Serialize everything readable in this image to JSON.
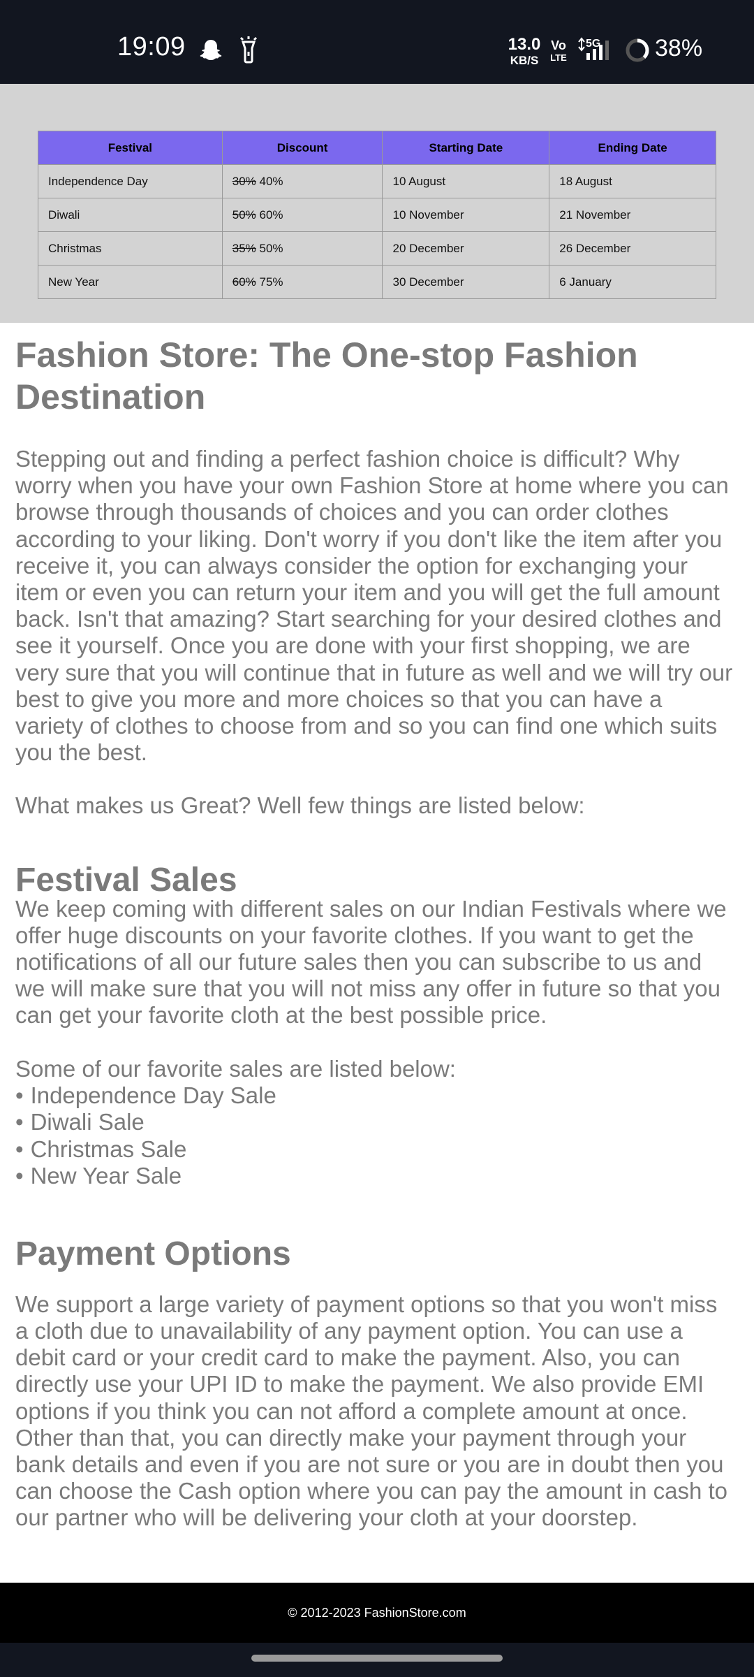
{
  "status_bar": {
    "time": "19:09",
    "net_speed_value": "13.0",
    "net_speed_unit": "KB/S",
    "volte_top": "Vo",
    "volte_bottom": "LTE",
    "network_type": "5G",
    "battery": "38%",
    "icons": [
      "snapchat-icon",
      "torch-icon",
      "signal-icon",
      "battery-ring-icon"
    ]
  },
  "table": {
    "headers": [
      "Festival",
      "Discount",
      "Starting Date",
      "Ending Date"
    ],
    "rows": [
      {
        "festival": "Independence Day",
        "old_discount": "30%",
        "discount": "40%",
        "start": "10 August",
        "end": "18 August"
      },
      {
        "festival": "Diwali",
        "old_discount": "50%",
        "discount": "60%",
        "start": "10 November",
        "end": "21 November"
      },
      {
        "festival": "Christmas",
        "old_discount": "35%",
        "discount": "50%",
        "start": "20 December",
        "end": "26 December"
      },
      {
        "festival": "New Year",
        "old_discount": "60%",
        "discount": "75%",
        "start": "30 December",
        "end": "6 January"
      }
    ]
  },
  "article": {
    "title": "Fashion Store: The One-stop Fashion Destination",
    "intro": "Stepping out and finding a perfect fashion choice is difficult? Why worry when you have your own Fashion Store at home where you can browse through thousands of choices and you can order clothes according to your liking. Don't worry if you don't like the item after you receive it, you can always consider the option for exchanging your item or even you can return your item and you will get the full amount back. Isn't that amazing? Start searching for your desired clothes and see it yourself. Once you are done with your first shopping, we are very sure that you will continue that in future as well and we will try our best to give you more and more choices so that you can have a variety of clothes to choose from and so you can find one which suits you the best.",
    "great": "What makes us Great? Well few things are listed below:",
    "festival_heading": "Festival Sales",
    "festival_text": "We keep coming with different sales on our Indian Festivals where we offer huge discounts on your favorite clothes. If you want to get the notifications of all our future sales then you can subscribe to us and we will make sure that you will not miss any offer in future so that you can get your favorite cloth at the best possible price.",
    "favorite_intro": "Some of our favorite sales are listed below:",
    "sales_list": [
      "Independence Day Sale",
      "Diwali Sale",
      "Christmas Sale",
      "New Year Sale"
    ],
    "payment_heading": "Payment Options",
    "payment_text": "We support a large variety of payment options so that you won't miss a cloth due to unavailability of any payment option. You can use a debit card or your credit card to make the payment. Also, you can directly use your UPI ID to make the payment. We also provide EMI options if you think you can not afford a complete amount at once. Other than that, you can directly make your payment through your bank details and even if you are not sure or you are in doubt then you can choose the Cash option where you can pay the amount in cash to our partner who will be delivering your cloth at your doorstep."
  },
  "footer": {
    "copyright": "© 2012-2023 FashionStore.com"
  },
  "colors": {
    "status_bar_bg": "#121620",
    "table_header_bg": "#7b68ee",
    "table_section_bg": "#d3d3d3",
    "text_gray": "#7a7a7a",
    "footer_bg": "#000000"
  }
}
